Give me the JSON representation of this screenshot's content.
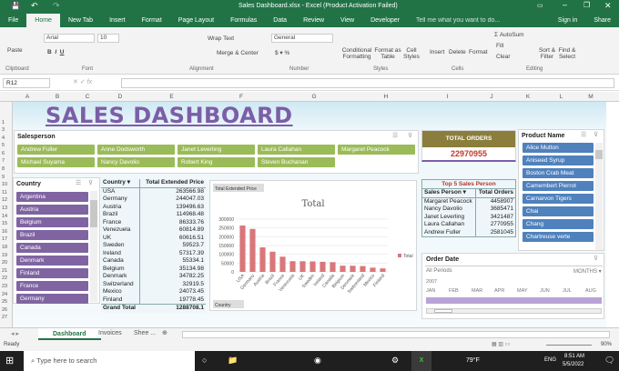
{
  "window": {
    "title": "Sales Dashboard.xlsx - Excel (Product Activation Failed)",
    "sign_in": "Sign in",
    "share": "Share"
  },
  "tabs": [
    "File",
    "Home",
    "New Tab",
    "Insert",
    "Format",
    "Page Layout",
    "Formulas",
    "Data",
    "Review",
    "View",
    "Developer"
  ],
  "tell_me": "Tell me what you want to do...",
  "ribbon": {
    "paste": "Paste",
    "clipboard": "Clipboard",
    "font_name": "Arial",
    "font_size": "10",
    "font": "Font",
    "wrap_text": "Wrap Text",
    "merge_center": "Merge & Center",
    "alignment": "Alignment",
    "number_format": "General",
    "number": "Number",
    "conditional": "Conditional Formatting",
    "format_table": "Format as Table",
    "cell_styles": "Cell Styles",
    "styles": "Styles",
    "insert": "Insert",
    "delete": "Delete",
    "format": "Format",
    "cells": "Cells",
    "autosum": "AutoSum",
    "fill": "Fill",
    "clear": "Clear",
    "sort_filter": "Sort & Filter",
    "find_select": "Find & Select",
    "editing": "Editing"
  },
  "name_box": "R12",
  "columns": [
    "A",
    "B",
    "C",
    "D",
    "E",
    "F",
    "G",
    "H",
    "I",
    "J",
    "K",
    "L",
    "M"
  ],
  "rows": [
    "1",
    "3",
    "4",
    "5",
    "6",
    "7",
    "8",
    "9",
    "10",
    "11",
    "12",
    "13",
    "14",
    "15",
    "16",
    "17",
    "18",
    "19",
    "20",
    "21",
    "22",
    "23",
    "24",
    "25",
    "26",
    "27"
  ],
  "dashboard_title": "SALES DASHBOARD",
  "salesperson_slicer": {
    "title": "Salesperson",
    "items": [
      "Andrew Fuller",
      "Anne Dodsworth",
      "Janet Leverling",
      "Laura Callahan",
      "Margaret Peacock",
      "Michael Suyama",
      "Nancy Davolio",
      "Robert King",
      "Steven Buchanan"
    ]
  },
  "country_slicer": {
    "title": "Country",
    "items": [
      "Argentina",
      "Austria",
      "Belgium",
      "Brazil",
      "Canada",
      "Denmark",
      "Finland",
      "France",
      "Germany"
    ]
  },
  "pivot": {
    "headers": [
      "Country",
      "Total Extended Price"
    ],
    "rows": [
      [
        "USA",
        "263566.98"
      ],
      [
        "Germany",
        "244047.03"
      ],
      [
        "Austria",
        "139496.63"
      ],
      [
        "Brazil",
        "114968.48"
      ],
      [
        "France",
        "86333.76"
      ],
      [
        "Venezuela",
        "60814.89"
      ],
      [
        "UK",
        "60616.51"
      ],
      [
        "Sweden",
        "59523.7"
      ],
      [
        "Ireland",
        "57317.39"
      ],
      [
        "Canada",
        "55334.1"
      ],
      [
        "Belgium",
        "35134.98"
      ],
      [
        "Denmark",
        "34782.25"
      ],
      [
        "Switzerland",
        "32919.5"
      ],
      [
        "Mexico",
        "24073.45"
      ],
      [
        "Finland",
        "19778.45"
      ]
    ],
    "grand_total_label": "Grand Total",
    "grand_total": "1288708.1"
  },
  "chart_data": {
    "type": "bar",
    "title": "Total",
    "field_button": "Total Extended Price",
    "axis_button": "Country",
    "categories": [
      "USA",
      "Germany",
      "Austria",
      "Brazil",
      "France",
      "Venezuela",
      "UK",
      "Sweden",
      "Ireland",
      "Canada",
      "Belgium",
      "Denmark",
      "Switzerland",
      "Mexico",
      "Finland"
    ],
    "series": [
      {
        "name": "Total",
        "values": [
          263566.98,
          244047.03,
          139496.63,
          114968.48,
          86333.76,
          60814.89,
          60616.51,
          59523.7,
          57317.39,
          55334.1,
          35134.98,
          34782.25,
          32919.5,
          24073.45,
          19778.45
        ]
      }
    ],
    "ylim": [
      0,
      300000
    ],
    "yticks": [
      "0",
      "50000",
      "100000",
      "150000",
      "200000",
      "250000",
      "300000"
    ],
    "legend": "right",
    "color": "#d9777a"
  },
  "total_orders": {
    "label": "TOTAL ORDERS",
    "value": "22970955"
  },
  "top5": {
    "title": "Top 5 Sales Person",
    "headers": [
      "Sales Person",
      "Total Orders"
    ],
    "rows": [
      [
        "Margaret Peacock",
        "4458907"
      ],
      [
        "Nancy Davolio",
        "3685471"
      ],
      [
        "Janet Leverling",
        "3421487"
      ],
      [
        "Laura Callahan",
        "2770955"
      ],
      [
        "Andrew Fuller",
        "2581045"
      ]
    ]
  },
  "product_slicer": {
    "title": "Product Name",
    "items": [
      "Alice Mutton",
      "Aniseed Syrup",
      "Boston Crab Meat",
      "Camembert Pierrot",
      "Carnarvon Tigers",
      "Chai",
      "Chang",
      "Chartreuse verte"
    ]
  },
  "timeline": {
    "title": "Order Date",
    "periods": "All Periods",
    "level": "MONTHS",
    "year": "2007",
    "months": [
      "JAN",
      "FEB",
      "MAR",
      "APR",
      "MAY",
      "JUN",
      "JUL",
      "AUG"
    ]
  },
  "sheet_tabs": [
    "Dashboard",
    "Invoices",
    "Shee ..."
  ],
  "status": {
    "ready": "Ready",
    "zoom": "90%"
  },
  "taskbar": {
    "search": "Type here to search",
    "weather": "79°F",
    "lang": "ENG",
    "time": "8:51 AM",
    "date": "5/5/2022"
  },
  "colors": {
    "excel_green": "#217346",
    "salesperson": "#9bbb59",
    "country": "#8064a2",
    "product": "#4f81bd",
    "title": "#7b5ea7",
    "total_header": "#8b7d3c",
    "total_value": "#c0392b"
  }
}
